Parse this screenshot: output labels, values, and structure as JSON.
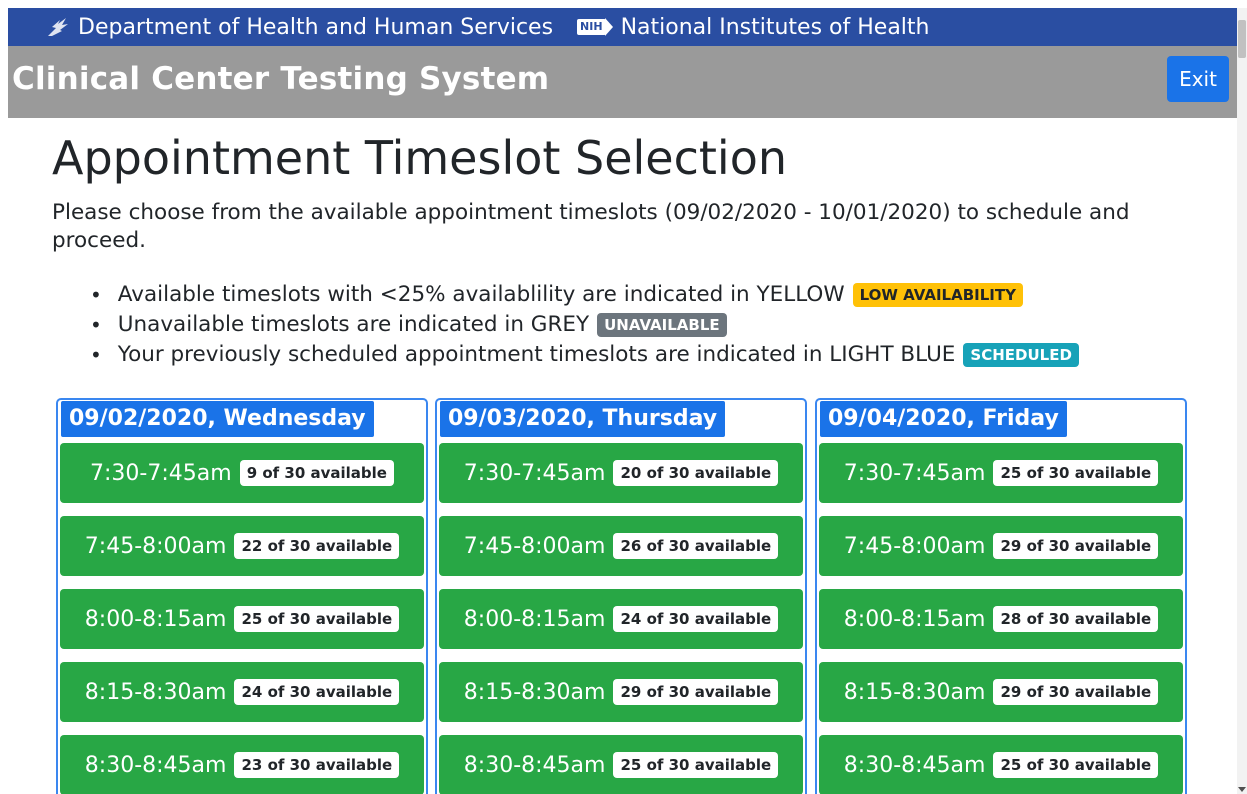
{
  "topbar": {
    "hhs": "Department of Health and Human Services",
    "nih_badge": "NIH",
    "nih": "National Institutes of Health"
  },
  "appbar": {
    "title": "Clinical Center Testing System",
    "exit_label": "Exit"
  },
  "page": {
    "title": "Appointment Timeslot Selection",
    "intro": "Please choose from the available appointment timeslots (09/02/2020 - 10/01/2020) to schedule and proceed."
  },
  "legend": [
    {
      "text": "Available timeslots with <25% availablility are indicated in YELLOW",
      "badge": "LOW AVAILABILITY"
    },
    {
      "text": "Unavailable timeslots are indicated in GREY",
      "badge": "UNAVAILABLE"
    },
    {
      "text": "Your previously scheduled appointment timeslots are indicated in LIGHT BLUE",
      "badge": "SCHEDULED"
    }
  ],
  "colors": {
    "top_bar": "#2a4ea2",
    "app_bar": "#9a9a9a",
    "primary": "#1a73e8",
    "available": "#28a745",
    "low_availability": "#ffc107",
    "unavailable": "#6c757d",
    "scheduled": "#17a2b8"
  },
  "days": [
    {
      "header": "09/02/2020, Wednesday",
      "slots": [
        {
          "time": "7:30-7:45am",
          "availability": "9 of 30 available"
        },
        {
          "time": "7:45-8:00am",
          "availability": "22 of 30 available"
        },
        {
          "time": "8:00-8:15am",
          "availability": "25 of 30 available"
        },
        {
          "time": "8:15-8:30am",
          "availability": "24 of 30 available"
        },
        {
          "time": "8:30-8:45am",
          "availability": "23 of 30 available"
        }
      ]
    },
    {
      "header": "09/03/2020, Thursday",
      "slots": [
        {
          "time": "7:30-7:45am",
          "availability": "20 of 30 available"
        },
        {
          "time": "7:45-8:00am",
          "availability": "26 of 30 available"
        },
        {
          "time": "8:00-8:15am",
          "availability": "24 of 30 available"
        },
        {
          "time": "8:15-8:30am",
          "availability": "29 of 30 available"
        },
        {
          "time": "8:30-8:45am",
          "availability": "25 of 30 available"
        }
      ]
    },
    {
      "header": "09/04/2020, Friday",
      "slots": [
        {
          "time": "7:30-7:45am",
          "availability": "25 of 30 available"
        },
        {
          "time": "7:45-8:00am",
          "availability": "29 of 30 available"
        },
        {
          "time": "8:00-8:15am",
          "availability": "28 of 30 available"
        },
        {
          "time": "8:15-8:30am",
          "availability": "29 of 30 available"
        },
        {
          "time": "8:30-8:45am",
          "availability": "25 of 30 available"
        }
      ]
    }
  ]
}
